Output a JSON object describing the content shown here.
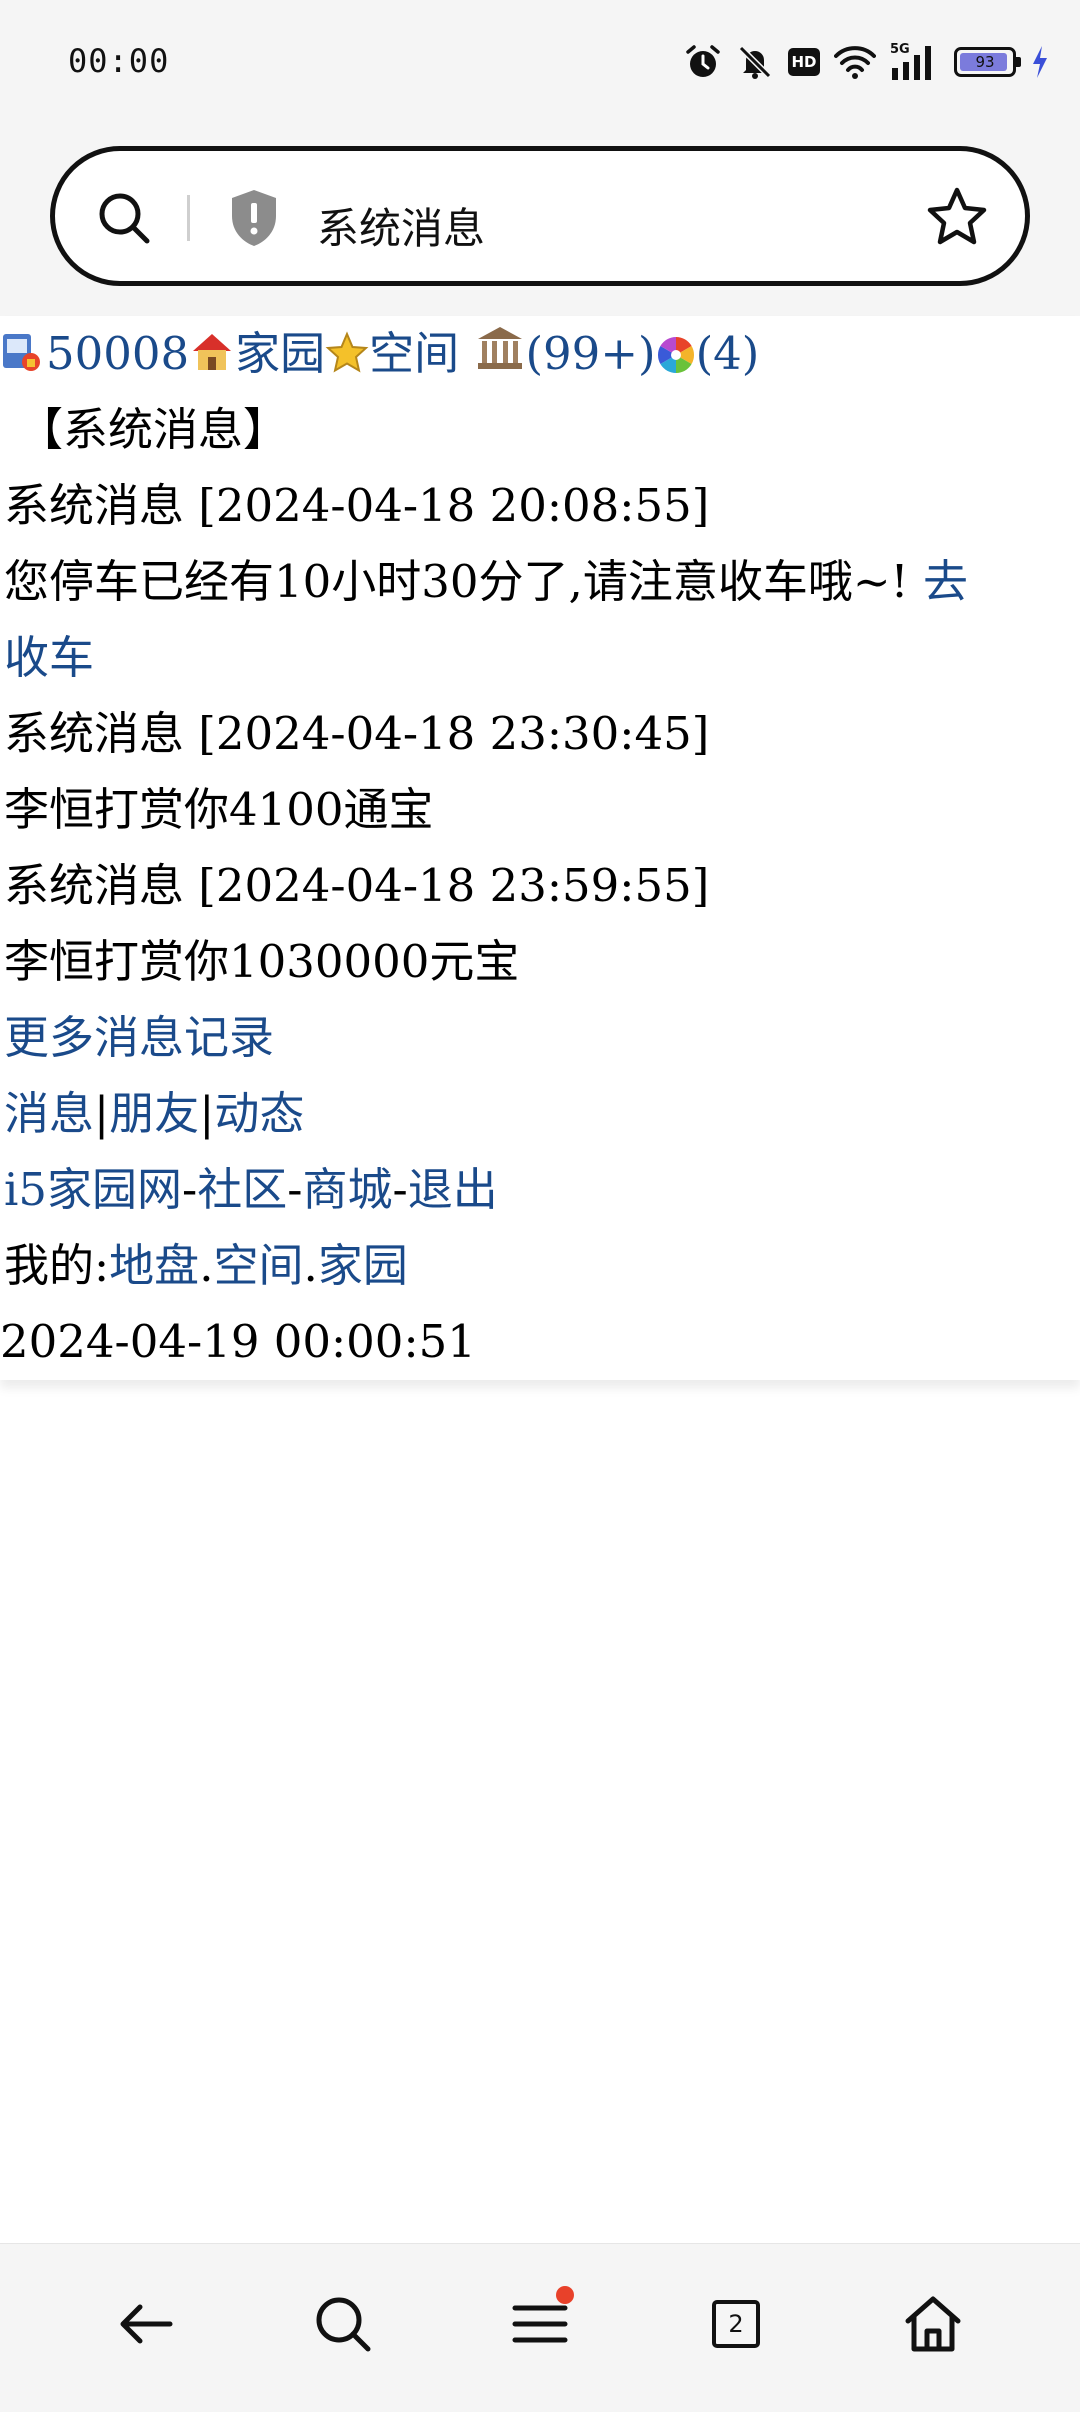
{
  "status_bar": {
    "time": "00:00",
    "hd_label": "HD",
    "network_label": "5G",
    "battery_level": "93",
    "battery_fraction": 0.93,
    "icons": [
      "alarm-icon",
      "mute-icon",
      "hd-icon",
      "wifi-icon",
      "signal-5g-icon",
      "battery-icon",
      "charging-icon"
    ]
  },
  "address_bar": {
    "page_title": "系统消息",
    "icons": [
      "search-icon",
      "security-shield-icon",
      "bookmark-star-icon"
    ]
  },
  "header_row": {
    "user_id": "50008",
    "home_label": "家园",
    "space_label": "空间",
    "bank_count": "(99+)",
    "other_count": "(4)"
  },
  "page_heading": "【系统消息】",
  "messages": [
    {
      "title": "系统消息 [2024-04-18 20:08:55]",
      "body": "您停车已经有10小时30分了,请注意收车哦~!",
      "action_line1": "去",
      "action_line2": "收车"
    },
    {
      "title": "系统消息 [2024-04-18 23:30:45]",
      "body": "李恒打赏你4100通宝"
    },
    {
      "title": "系统消息 [2024-04-18 23:59:55]",
      "body": "李恒打赏你1030000元宝"
    }
  ],
  "more_link": "更多消息记录",
  "tabs": {
    "messages": "消息",
    "friends": "朋友",
    "feed": "动态",
    "separator": "|"
  },
  "site_links": {
    "site": "i5家园网",
    "community": "社区",
    "mall": "商城",
    "logout": "退出",
    "dash": "-"
  },
  "my_links": {
    "prefix": "我的:",
    "land": "地盘",
    "space": "空间",
    "home": "家园",
    "dot": "."
  },
  "footer_time": "2024-04-19 00:00:51",
  "bottom_nav": {
    "tab_count": "2",
    "icons": [
      "back-arrow-icon",
      "search-icon",
      "menu-icon",
      "tabs-icon",
      "home-icon"
    ]
  }
}
